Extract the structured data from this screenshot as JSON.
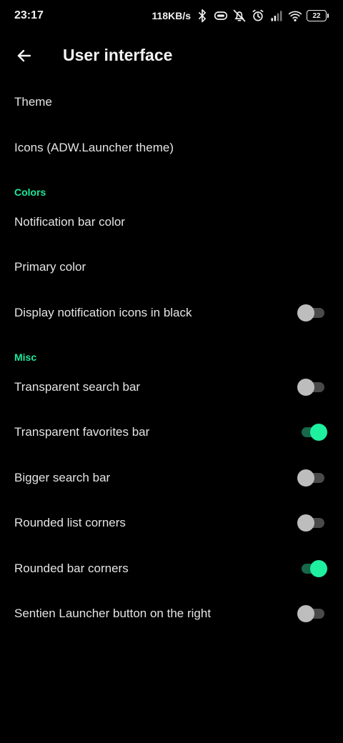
{
  "status_bar": {
    "time": "23:17",
    "net_speed": "118KB/s",
    "battery_level": "22",
    "icons": [
      "bluetooth-icon",
      "hd-voice-icon",
      "mute-icon",
      "alarm-icon",
      "signal-icon",
      "wifi-icon",
      "battery-icon"
    ]
  },
  "header": {
    "title": "User interface",
    "back_icon": "arrow-left-icon"
  },
  "colors": {
    "accent": "#1ee89a",
    "background": "#000000",
    "toggle_on_track": "#17684a",
    "toggle_off_thumb": "#bdbdbd"
  },
  "items": {
    "theme": "Theme",
    "icons": "Icons (ADW.Launcher theme)",
    "colors_header": "Colors",
    "notification_bar_color": "Notification bar color",
    "primary_color": "Primary color",
    "notif_icons_black": {
      "label": "Display notification icons in black",
      "checked": false
    },
    "misc_header": "Misc",
    "transparent_search_bar": {
      "label": "Transparent search bar",
      "checked": false
    },
    "transparent_favorites_bar": {
      "label": "Transparent favorites bar",
      "checked": true
    },
    "bigger_search_bar": {
      "label": "Bigger search bar",
      "checked": false
    },
    "rounded_list_corners": {
      "label": "Rounded list corners",
      "checked": false
    },
    "rounded_bar_corners": {
      "label": "Rounded bar corners",
      "checked": true
    },
    "launcher_button_right": {
      "label": "Sentien Launcher button on the right",
      "checked": false
    }
  }
}
